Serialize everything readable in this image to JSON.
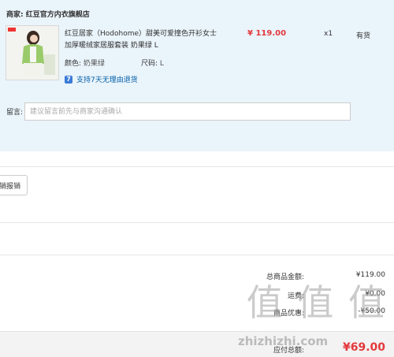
{
  "merchant": {
    "label": "商家:",
    "name": "红豆官方内衣旗舰店"
  },
  "product": {
    "title": "红豆居家（Hodohome）甜美可爱撞色开衫女士加厚暖绒家居服套装 奶果绿 L",
    "price": "¥ 119.00",
    "qty": "x1",
    "stock": "有货",
    "color_label": "颜色:",
    "color_value": "奶果绿",
    "size_label": "尺码:",
    "size_value": "L",
    "return_icon": "7",
    "return_text": "支持7天无理由退货"
  },
  "note": {
    "label": "留言:",
    "placeholder": "建议留言前先与商家沟通确认"
  },
  "reimb_button": "销报销",
  "summary": {
    "goods_label": "总商品金额:",
    "goods_value": "¥119.00",
    "freight_label": "运费:",
    "freight_value": "¥0.00",
    "discount_label": "商品优惠:",
    "discount_value": "-¥50.00",
    "pay_label": "应付总额:",
    "pay_value": "¥69.00"
  },
  "watermark": {
    "text": "值 值 值",
    "url": "zhizhizhi.com"
  },
  "colors": {
    "accent_red": "#e4393c",
    "panel_bg": "#eaf4fb",
    "link_blue": "#005ea7"
  }
}
